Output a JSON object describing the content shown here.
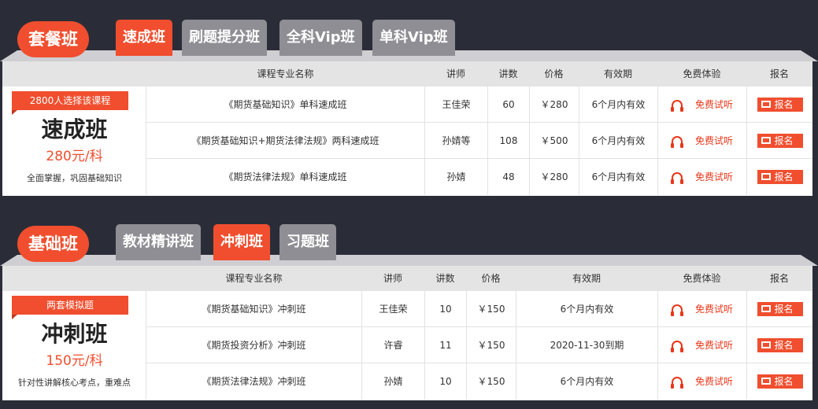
{
  "colors": {
    "background": "#2a2d38",
    "accent": "#f04e2e",
    "tab_inactive": "#8e8e94",
    "header_row": "#e4e4e4"
  },
  "headers": {
    "course": "课程专业名称",
    "teacher": "讲师",
    "lessons": "讲数",
    "price": "价格",
    "validity": "有效期",
    "trial": "免费体验",
    "signup": "报名"
  },
  "trial_label": "免费试听",
  "signup_label": "报名",
  "section1": {
    "pill": "套餐班",
    "tabs": [
      "速成班",
      "刷题提分班",
      "全科Vip班",
      "单科Vip班"
    ],
    "active_tab": "速成班",
    "promo": {
      "ribbon": "2800人选择该课程",
      "name": "速成班",
      "price": "280元/科",
      "desc": "全面掌握，巩固基础知识"
    },
    "rows": [
      {
        "course": "《期货基础知识》单科速成班",
        "teacher": "王佳荣",
        "lessons": "60",
        "price": "￥280",
        "validity": "6个月内有效"
      },
      {
        "course": "《期货基础知识+期货法律法规》两科速成班",
        "teacher": "孙婧等",
        "lessons": "108",
        "price": "￥500",
        "validity": "6个月内有效"
      },
      {
        "course": "《期货法律法规》单科速成班",
        "teacher": "孙婧",
        "lessons": "48",
        "price": "￥280",
        "validity": "6个月内有效"
      }
    ]
  },
  "section2": {
    "pill": "基础班",
    "tabs": [
      "教材精讲班",
      "冲刺班",
      "习题班"
    ],
    "active_tab": "冲刺班",
    "promo": {
      "ribbon": "两套模拟题",
      "name": "冲刺班",
      "price": "150元/科",
      "desc": "针对性讲解核心考点，重难点"
    },
    "rows": [
      {
        "course": "《期货基础知识》冲刺班",
        "teacher": "王佳荣",
        "lessons": "10",
        "price": "￥150",
        "validity": "6个月内有效"
      },
      {
        "course": "《期货投资分析》冲刺班",
        "teacher": "许睿",
        "lessons": "11",
        "price": "￥150",
        "validity": "2020-11-30到期"
      },
      {
        "course": "《期货法律法规》冲刺班",
        "teacher": "孙婧",
        "lessons": "10",
        "price": "￥150",
        "validity": "6个月内有效"
      }
    ]
  }
}
